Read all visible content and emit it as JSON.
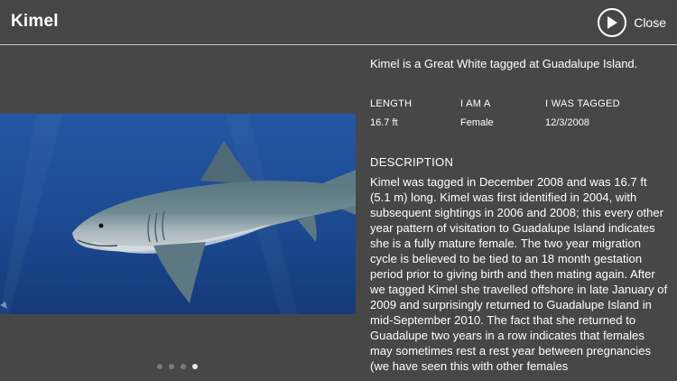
{
  "header": {
    "title": "Kimel",
    "close_label": "Close",
    "play_icon": "play-icon"
  },
  "gallery": {
    "image_subject": "shark-photo",
    "dot_count": 4,
    "active_dot": 4
  },
  "info": {
    "summary": "Kimel is a Great White tagged at Guadalupe Island.",
    "stats": {
      "length_label": "LENGTH",
      "length_value": "16.7 ft",
      "gender_label": "I AM A",
      "gender_value": "Female",
      "tagged_label": "I WAS TAGGED",
      "tagged_value": "12/3/2008"
    },
    "description_heading": "DESCRIPTION",
    "description": "Kimel was tagged in December 2008 and was 16.7 ft (5.1 m) long. Kimel was first identified in 2004, with subsequent sightings in 2006 and 2008; this every other year pattern of visitation to Guadalupe Island indicates she is a fully mature female.  The two year migration cycle is believed to be tied to an 18 month gestation period prior to giving birth and then mating again. After we tagged Kimel she travelled offshore in late January of 2009 and surprisingly returned to Guadalupe Island in mid-September 2010. The fact that she returned to Guadalupe two years in a row indicates that females may sometimes rest a rest year between pregnancies (we have seen this with other females"
  },
  "colors": {
    "background": "#474747",
    "text": "#ffffff",
    "ocean": "#1f4c93",
    "divider": "#c8c8c8"
  }
}
